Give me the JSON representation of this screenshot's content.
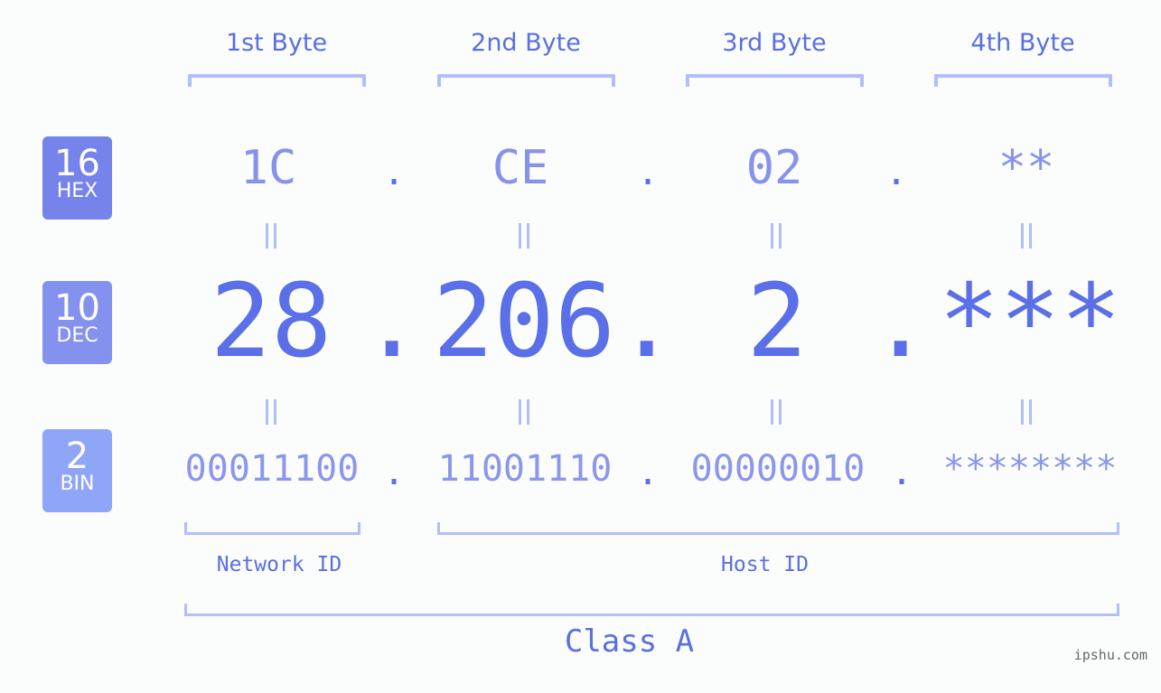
{
  "bytes": [
    {
      "label": "1st Byte",
      "hex": "1C",
      "dec": "28",
      "bin": "00011100"
    },
    {
      "label": "2nd Byte",
      "hex": "CE",
      "dec": "206",
      "bin": "11001110"
    },
    {
      "label": "3rd Byte",
      "hex": "02",
      "dec": "2",
      "bin": "00000010"
    },
    {
      "label": "4th Byte",
      "hex": "**",
      "dec": "***",
      "bin": "********"
    }
  ],
  "separator": ".",
  "badges": {
    "hex": {
      "num": "16",
      "label": "HEX",
      "color": "#7583ea"
    },
    "dec": {
      "num": "10",
      "label": "DEC",
      "color": "#8491ef"
    },
    "bin": {
      "num": "2",
      "label": "BIN",
      "color": "#8fa5f8"
    }
  },
  "network_id": "Network ID",
  "host_id": "Host ID",
  "class_label": "Class A",
  "brand": "ipshu.com",
  "colors": {
    "primary": "#5a6fe8",
    "hex_text": "#8792ec",
    "bin_text": "#8b96ec",
    "bracket": "#b3bdf7",
    "background": "#fbfdfc"
  }
}
